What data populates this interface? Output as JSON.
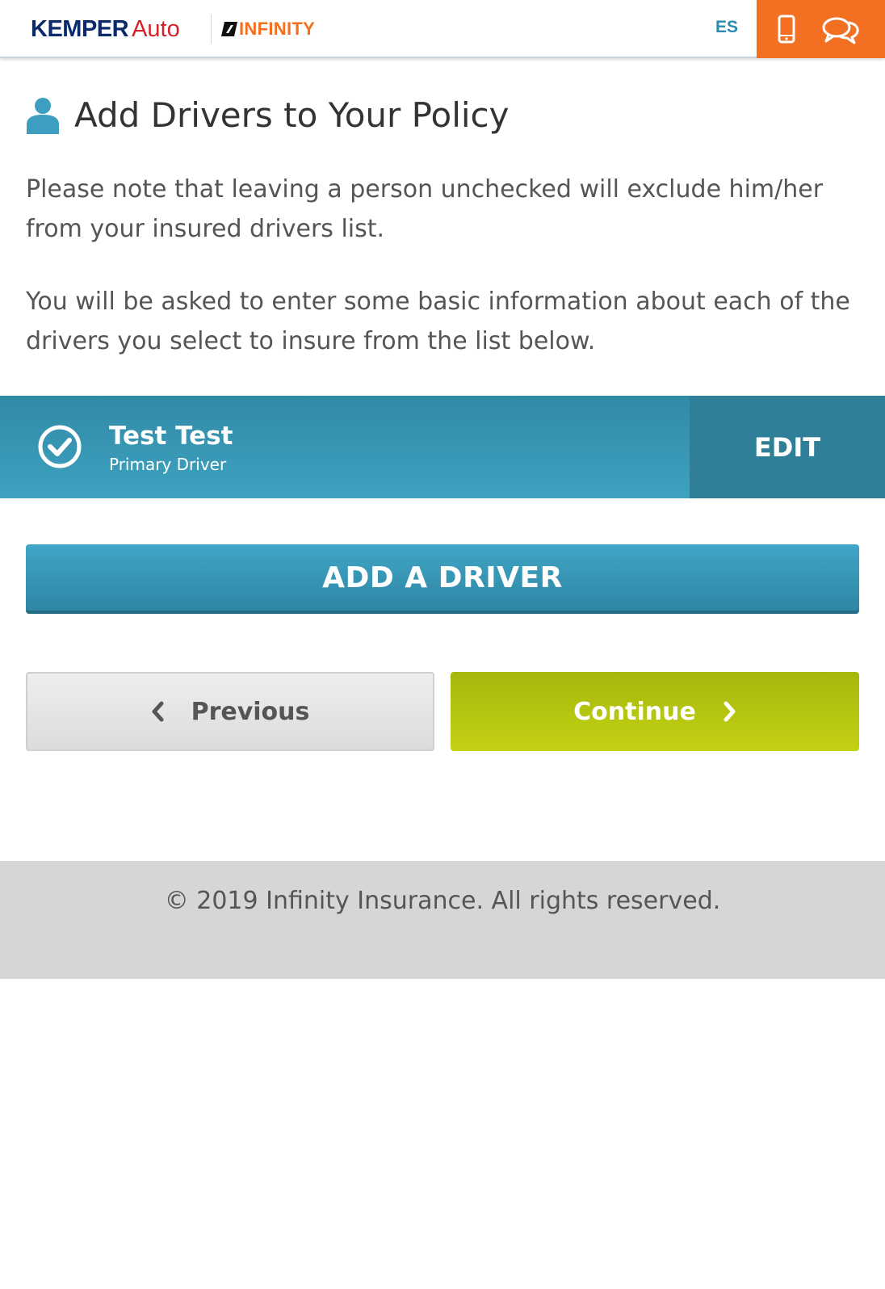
{
  "header": {
    "brand_kemper": "KEMPER",
    "brand_auto": "Auto",
    "brand_infinity": "INFINITY",
    "language_toggle": "ES",
    "phone_icon": "phone-icon",
    "chat_icon": "chat-icon",
    "accent_color": "#f36f21"
  },
  "main": {
    "title": "Add Drivers to Your Policy",
    "title_icon": "person-icon",
    "note_1": "Please note that leaving a person unchecked will exclude him/her from your insured drivers list.",
    "note_2": "You will be asked to enter some basic information about each of the drivers you select to insure from the list below."
  },
  "drivers": [
    {
      "name": "Test Test",
      "role": "Primary Driver",
      "checked": true,
      "edit_label": "EDIT"
    }
  ],
  "actions": {
    "add_driver_label": "ADD A DRIVER",
    "previous_label": "Previous",
    "continue_label": "Continue"
  },
  "footer": {
    "copyright": "© 2019 Infinity Insurance. All rights reserved."
  },
  "colors": {
    "primary_blue": "#3ea2c0",
    "continue_green": "#b4c312",
    "footer_gray": "#d6d6d6"
  }
}
